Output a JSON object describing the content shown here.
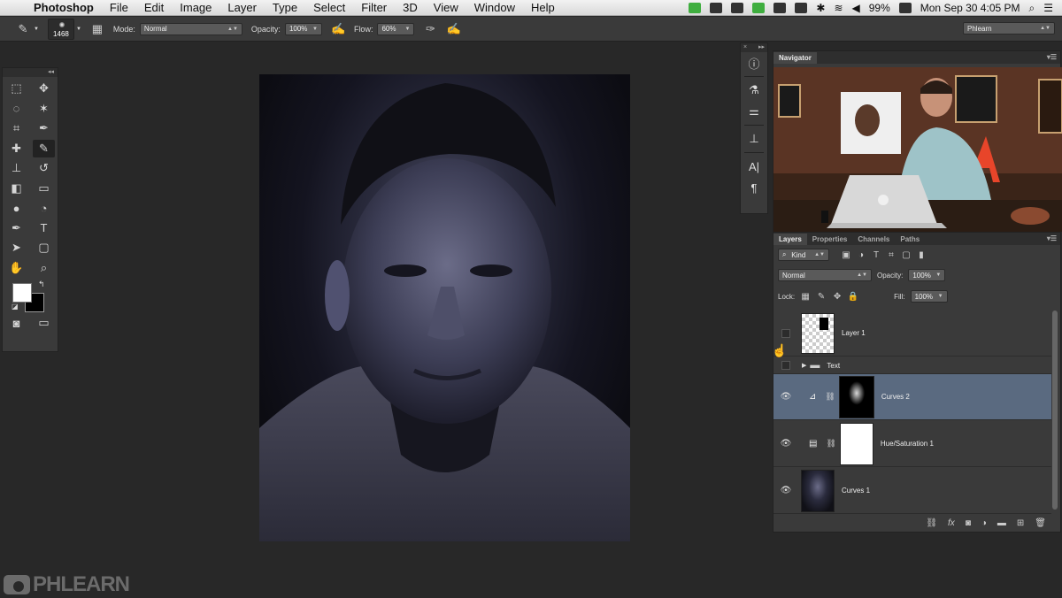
{
  "menubar": {
    "app_name": "Photoshop",
    "menus": [
      "File",
      "Edit",
      "Image",
      "Layer",
      "Type",
      "Select",
      "Filter",
      "3D",
      "View",
      "Window",
      "Help"
    ],
    "battery": "99%",
    "datetime": "Mon Sep 30  4:05 PM"
  },
  "options_bar": {
    "brush_size": "1468",
    "mode_label": "Mode:",
    "mode_value": "Normal",
    "opacity_label": "Opacity:",
    "opacity_value": "100%",
    "flow_label": "Flow:",
    "flow_value": "60%",
    "workspace": "Phlearn"
  },
  "dock_panel": {
    "icons": [
      "info-icon",
      "brush-presets-icon",
      "brush-options-icon",
      "clone-source-icon",
      "character-icon",
      "paragraph-icon"
    ]
  },
  "navigator": {
    "tab": "Navigator"
  },
  "layers_panel": {
    "tabs": [
      "Layers",
      "Properties",
      "Channels",
      "Paths"
    ],
    "filter_kind": "Kind",
    "blend_mode": "Normal",
    "opacity_label": "Opacity:",
    "opacity_value": "100%",
    "lock_label": "Lock:",
    "fill_label": "Fill:",
    "fill_value": "100%",
    "layers": [
      {
        "name": "Layer 1",
        "visible": false
      },
      {
        "name": "Text",
        "visible": false
      },
      {
        "name": "Curves 2",
        "visible": true,
        "selected": true
      },
      {
        "name": "Hue/Saturation 1",
        "visible": true
      },
      {
        "name": "Curves 1",
        "visible": true
      }
    ]
  },
  "watermark": {
    "text": "PHLEARN"
  },
  "colors": {
    "panel_bg": "#3a3a3a",
    "workspace_bg": "#282828",
    "selected_layer": "#5a6a80"
  }
}
